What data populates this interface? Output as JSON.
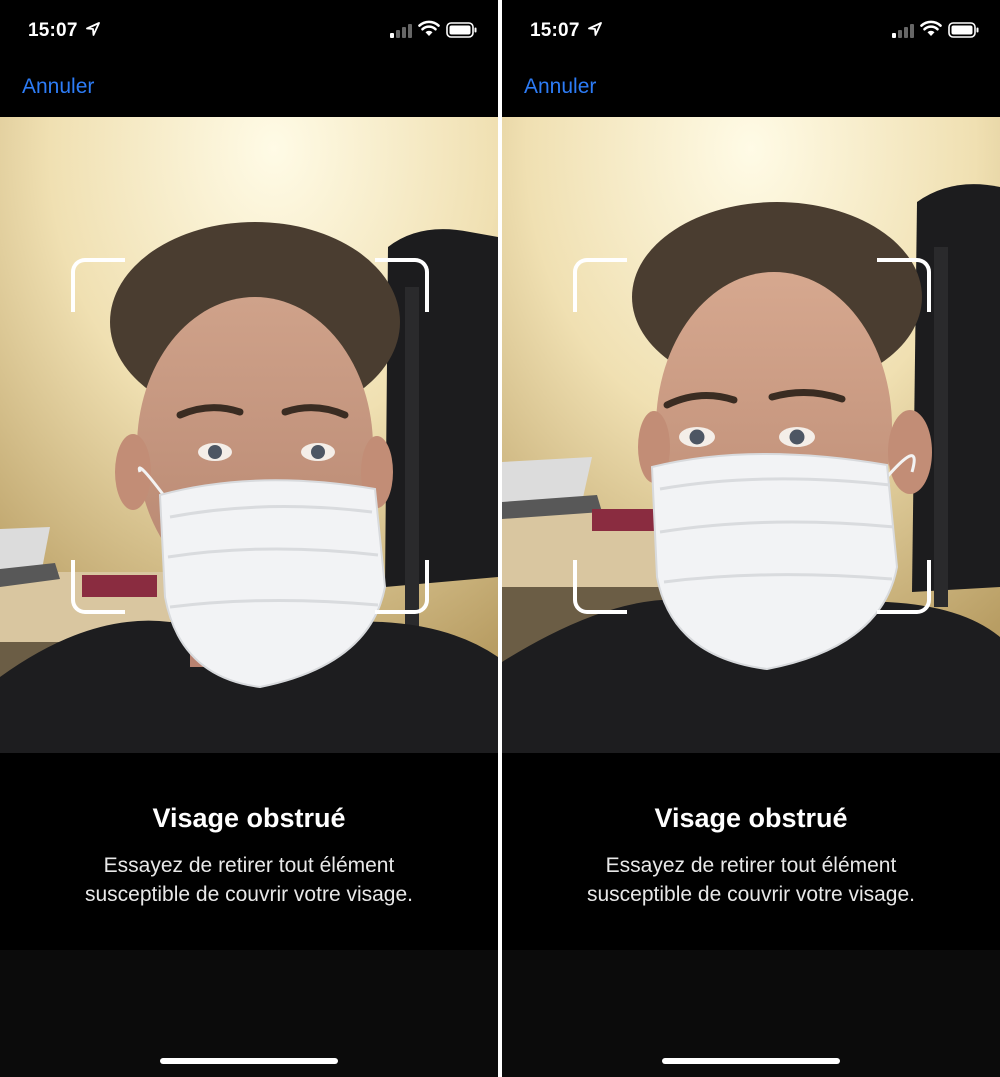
{
  "screens": [
    {
      "status": {
        "time": "15:07"
      },
      "nav": {
        "cancel_label": "Annuler"
      },
      "message": {
        "title": "Visage obstrué",
        "line1": "Essayez de retirer tout élément",
        "line2": "susceptible de couvrir votre visage."
      }
    },
    {
      "status": {
        "time": "15:07"
      },
      "nav": {
        "cancel_label": "Annuler"
      },
      "message": {
        "title": "Visage obstrué",
        "line1": "Essayez de retirer tout élément",
        "line2": "susceptible de couvrir votre visage."
      }
    }
  ],
  "icons": [
    "location-arrow-icon",
    "cellular-signal-icon",
    "wifi-icon",
    "battery-icon"
  ],
  "colors": {
    "accent": "#2d7cf6",
    "background": "#000000",
    "text": "#ffffff"
  }
}
